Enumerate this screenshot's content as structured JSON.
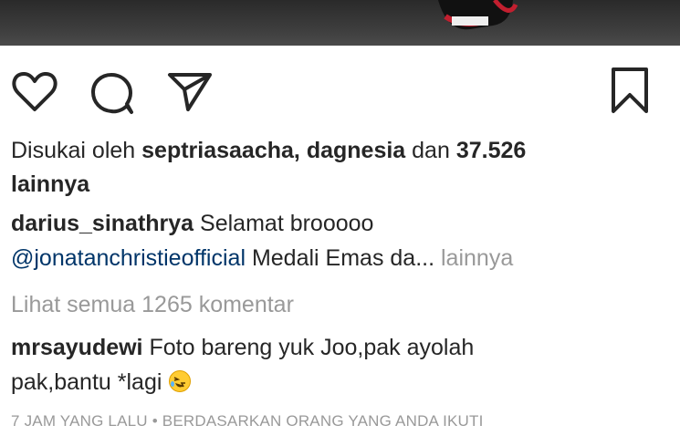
{
  "post": {
    "liked_by_prefix": "Disukai oleh",
    "liked_user_1": "septriasaacha",
    "liked_sep": ",",
    "liked_user_2": "dagnesia",
    "liked_and": "dan",
    "liked_count": "37.526",
    "liked_others": "lainnya",
    "caption_user": "darius_sinathrya",
    "caption_text": "Selamat brooooo",
    "caption_mention": "@jonatanchristieofficial",
    "caption_text_2": "Medali Emas da...",
    "caption_more": "lainnya",
    "view_comments": "Lihat semua 1265 komentar",
    "comment_user": "mrsayudewi",
    "comment_text_1": "Foto bareng yuk Joo,pak ayolah",
    "comment_text_2": "pak,bantu *lagi",
    "comment_emoji": "rolling-on-floor-laughing-emoji",
    "footer_time": "7 JAM YANG LALU",
    "footer_sep": "•",
    "footer_note": "BERDASARKAN ORANG YANG ANDA IKUTI"
  },
  "icons": {
    "like": "heart-icon",
    "comment": "comment-icon",
    "share": "send-icon",
    "save": "bookmark-icon"
  }
}
